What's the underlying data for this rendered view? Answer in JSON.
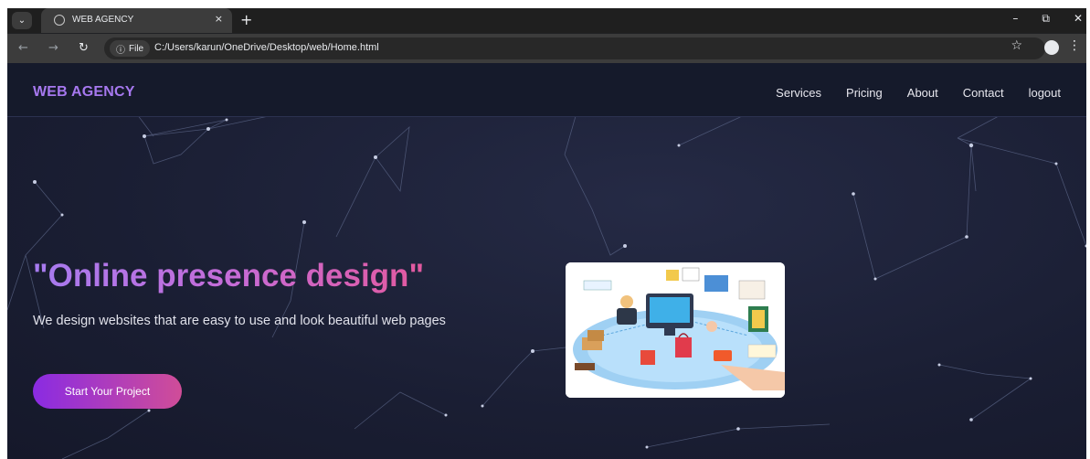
{
  "browser": {
    "tab_title": "WEB AGENCY",
    "new_tab_symbol": "+",
    "close_symbol": "×",
    "site_info_label": "File",
    "url": "C:/Users/karun/OneDrive/Desktop/web/Home.html",
    "icons": [
      "tab-search-icon",
      "globe-icon",
      "close-icon",
      "plus-icon",
      "back-icon",
      "forward-icon",
      "reload-icon",
      "info-icon",
      "star-icon",
      "profile-icon",
      "menu-icon",
      "minimize-icon",
      "restore-icon",
      "window-close-icon"
    ]
  },
  "navbar": {
    "brand": "WEB AGENCY",
    "links": [
      "Services",
      "Pricing",
      "About",
      "Contact",
      "logout"
    ]
  },
  "hero": {
    "title": "\"Online presence design\"",
    "subtitle": "We design websites that are easy to use and look beautiful web pages",
    "cta_label": "Start Your Project"
  },
  "colors": {
    "brand": "#a678ef",
    "page_bg": "#1b1f35",
    "navbar_bg": "#151a2b",
    "title_gradient_start": "#a67bf0",
    "title_gradient_end": "#e3599f",
    "cta_gradient_start": "#8a2be2",
    "cta_gradient_end": "#d04d98"
  }
}
